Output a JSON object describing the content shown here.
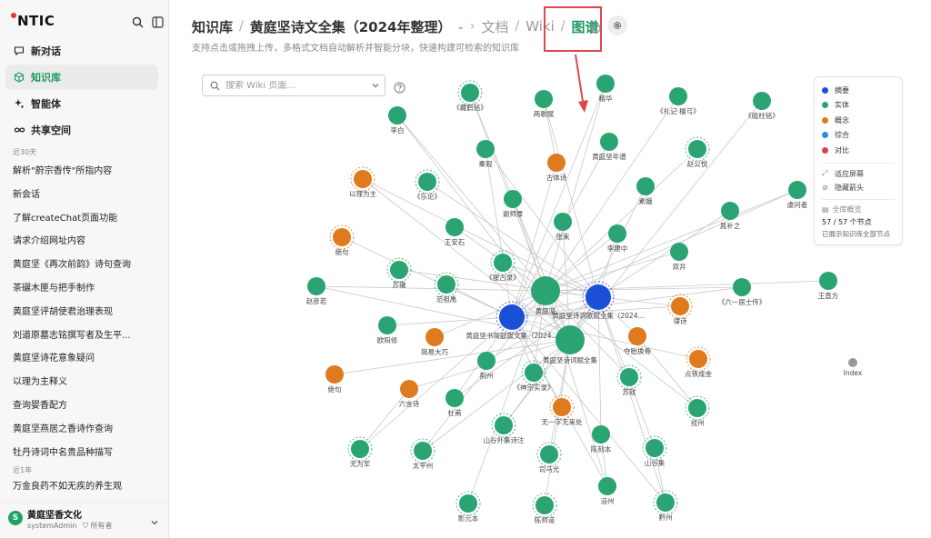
{
  "sidebar": {
    "brand": "NTIC",
    "nav": [
      {
        "label": "新对话",
        "icon": "chat-edit-icon"
      },
      {
        "label": "知识库",
        "icon": "cube-icon"
      },
      {
        "label": "智能体",
        "icon": "sparkle-icon"
      },
      {
        "label": "共享空间",
        "icon": "infinity-icon"
      }
    ],
    "section_recent": "近30天",
    "history": [
      "解析\"蔚宗香传\"所指内容",
      "新会话",
      "了解createChat页面功能",
      "请求介绍网址内容",
      "黄庭坚《再次前韵》诗句查询",
      "茶碾木匣与把手制作",
      "黄庭坚评胡使君治理表现",
      "刘道原墓志铭撰写者及生平...",
      "黄庭坚诗花意象疑问",
      "以理为主释义",
      "查询婴香配方",
      "黄庭坚燕居之香诗作查询",
      "牡丹诗词中名贵品种描写"
    ],
    "section_year": "近1年",
    "history_year": [
      "万金良药不如无疾的养生观"
    ],
    "user": {
      "initial": "S",
      "name": "黄庭坚香文化",
      "account": "systemAdmin",
      "role": "所有者"
    }
  },
  "header": {
    "crumb1": "知识库",
    "crumb2": "黄庭坚诗文全集（2024年整理）",
    "crumb3": "文档",
    "crumb4": "Wiki",
    "crumb5": "图谱",
    "subtitle": "支持点击或拖拽上传，多格式文档自动解析并智能分块，快速构建可检索的知识库"
  },
  "search": {
    "placeholder": "搜索 Wiki 页面..."
  },
  "legend": {
    "types": [
      {
        "label": "摘要",
        "color": "#1a4fd6"
      },
      {
        "label": "实体",
        "color": "#2aa472"
      },
      {
        "label": "概念",
        "color": "#e07a1f"
      },
      {
        "label": "综合",
        "color": "#2a8fe0"
      },
      {
        "label": "对比",
        "color": "#d9443f"
      }
    ],
    "fit_label": "适应屏幕",
    "hide_arrows_label": "隐藏箭头",
    "overview_label": "全库概览",
    "count_text": "57 / 57 个节点",
    "note_text": "已展示知识库全部节点"
  },
  "graph": {
    "nodes": [
      {
        "label": "《藏鹤铭》",
        "type": "entity",
        "dashed": true
      },
      {
        "label": "李白",
        "type": "entity"
      },
      {
        "label": "两歌赋",
        "type": "entity"
      },
      {
        "label": "精华",
        "type": "entity"
      },
      {
        "label": "《礼记·檀弓》",
        "type": "entity"
      },
      {
        "label": "《砥柱铭》",
        "type": "entity"
      },
      {
        "label": "秦观",
        "type": "entity"
      },
      {
        "label": "黄庭坚年谱",
        "type": "entity"
      },
      {
        "label": "赵公悦",
        "type": "entity",
        "dashed": true
      },
      {
        "label": "以理为主",
        "type": "concept",
        "dashed": true
      },
      {
        "label": "《乐论》",
        "type": "entity",
        "dashed": true
      },
      {
        "label": "古体诗",
        "type": "concept"
      },
      {
        "label": "谢师厚",
        "type": "entity"
      },
      {
        "label": "素娥",
        "type": "entity"
      },
      {
        "label": "晁补之",
        "type": "entity"
      },
      {
        "label": "虞问者",
        "type": "entity"
      },
      {
        "label": "王安石",
        "type": "entity"
      },
      {
        "label": "张耒",
        "type": "entity"
      },
      {
        "label": "李建中",
        "type": "entity"
      },
      {
        "label": "绝句",
        "type": "concept",
        "dashed": true
      },
      {
        "label": "双井",
        "type": "entity"
      },
      {
        "label": "《猩古录》",
        "type": "entity",
        "dashed": true
      },
      {
        "label": "苏辙",
        "type": "entity",
        "dashed": true
      },
      {
        "label": "范祖禹",
        "type": "entity",
        "dashed": true
      },
      {
        "label": "赵彦若",
        "type": "entity"
      },
      {
        "label": "黄庭坚",
        "type": "entity",
        "big": true
      },
      {
        "label": "黄庭坚诗词歌赋全集（2024...",
        "type": "summary",
        "dashed": true
      },
      {
        "label": "《六一居士传》",
        "type": "entity"
      },
      {
        "label": "王直方",
        "type": "entity"
      },
      {
        "label": "黄庭坚书简题跋文集（2024...",
        "type": "summary",
        "dashed": true
      },
      {
        "label": "律诗",
        "type": "concept",
        "dashed": true
      },
      {
        "label": "欧阳修",
        "type": "entity"
      },
      {
        "label": "简易大巧",
        "type": "concept"
      },
      {
        "label": "黄庭坚诗词赋全集",
        "type": "entity",
        "big": true
      },
      {
        "label": "夺胎换骨",
        "type": "concept"
      },
      {
        "label": "点铁成金",
        "type": "concept",
        "dashed": true
      },
      {
        "label": "Index",
        "type": "other"
      },
      {
        "label": "绝句",
        "type": "concept"
      },
      {
        "label": "荆州",
        "type": "entity"
      },
      {
        "label": "《神宗实录》",
        "type": "entity",
        "dashed": true
      },
      {
        "label": "苏轼",
        "type": "entity",
        "dashed": true
      },
      {
        "label": "六言诗",
        "type": "concept"
      },
      {
        "label": "杜甫",
        "type": "entity"
      },
      {
        "label": "无一字无来处",
        "type": "concept",
        "dashed": true
      },
      {
        "label": "戎州",
        "type": "entity",
        "dashed": true
      },
      {
        "label": "山谷外集诗注",
        "type": "entity",
        "dashed": true
      },
      {
        "label": "陈刻本",
        "type": "entity"
      },
      {
        "label": "无为军",
        "type": "entity",
        "dashed": true
      },
      {
        "label": "太平州",
        "type": "entity",
        "dashed": true
      },
      {
        "label": "司马光",
        "type": "entity",
        "dashed": true
      },
      {
        "label": "山谷集",
        "type": "entity",
        "dashed": true
      },
      {
        "label": "涪州",
        "type": "entity"
      },
      {
        "label": "影元本",
        "type": "entity",
        "dashed": true
      },
      {
        "label": "陈师道",
        "type": "entity",
        "dashed": true
      },
      {
        "label": "黔州",
        "type": "entity",
        "dashed": true
      }
    ]
  }
}
